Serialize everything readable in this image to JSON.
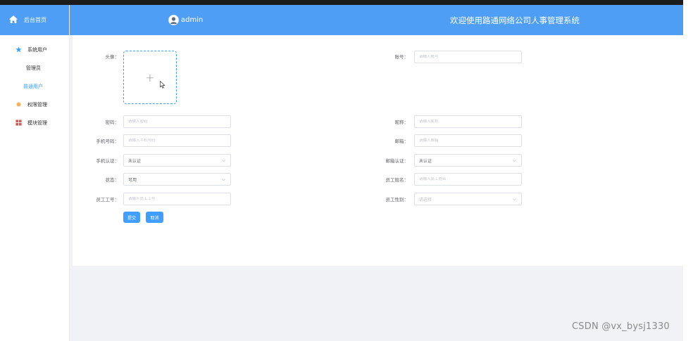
{
  "sidebar": {
    "home_label": "后台首页",
    "items": [
      {
        "label": "系统用户"
      },
      {
        "label": "管理员"
      },
      {
        "label": "普通用户"
      },
      {
        "label": "权限管理"
      },
      {
        "label": "模块管理"
      }
    ]
  },
  "header": {
    "username": "admin",
    "title": "欢迎使用路通网络公司人事管理系统"
  },
  "form": {
    "avatar_label": "头像：",
    "account": {
      "label": "账号：",
      "placeholder": "请输入账号"
    },
    "password": {
      "label": "密码：",
      "placeholder": "请输入密码"
    },
    "nickname": {
      "label": "昵称：",
      "placeholder": "请输入昵称"
    },
    "phone": {
      "label": "手机号码：",
      "placeholder": "请输入手机号码"
    },
    "email": {
      "label": "邮箱：",
      "placeholder": "请输入邮箱"
    },
    "phone_verify": {
      "label": "手机认证：",
      "value": "未认证"
    },
    "email_verify": {
      "label": "邮箱认证：",
      "value": "未认证"
    },
    "status": {
      "label": "状态：",
      "value": "可用"
    },
    "employee_name": {
      "label": "员工姓名：",
      "placeholder": "请输入员工姓名"
    },
    "employee_no": {
      "label": "员工工号：",
      "placeholder": "请输入员工工号"
    },
    "employee_gender": {
      "label": "员工性别：",
      "placeholder": "请选择"
    },
    "submit_label": "提交",
    "cancel_label": "取消"
  },
  "watermark": "CSDN @vx_bysj1330",
  "colors": {
    "primary": "#409eff",
    "header_bg": "#4e9ef6",
    "content_bg": "#f0f2f5",
    "border": "#dcdfe6"
  }
}
